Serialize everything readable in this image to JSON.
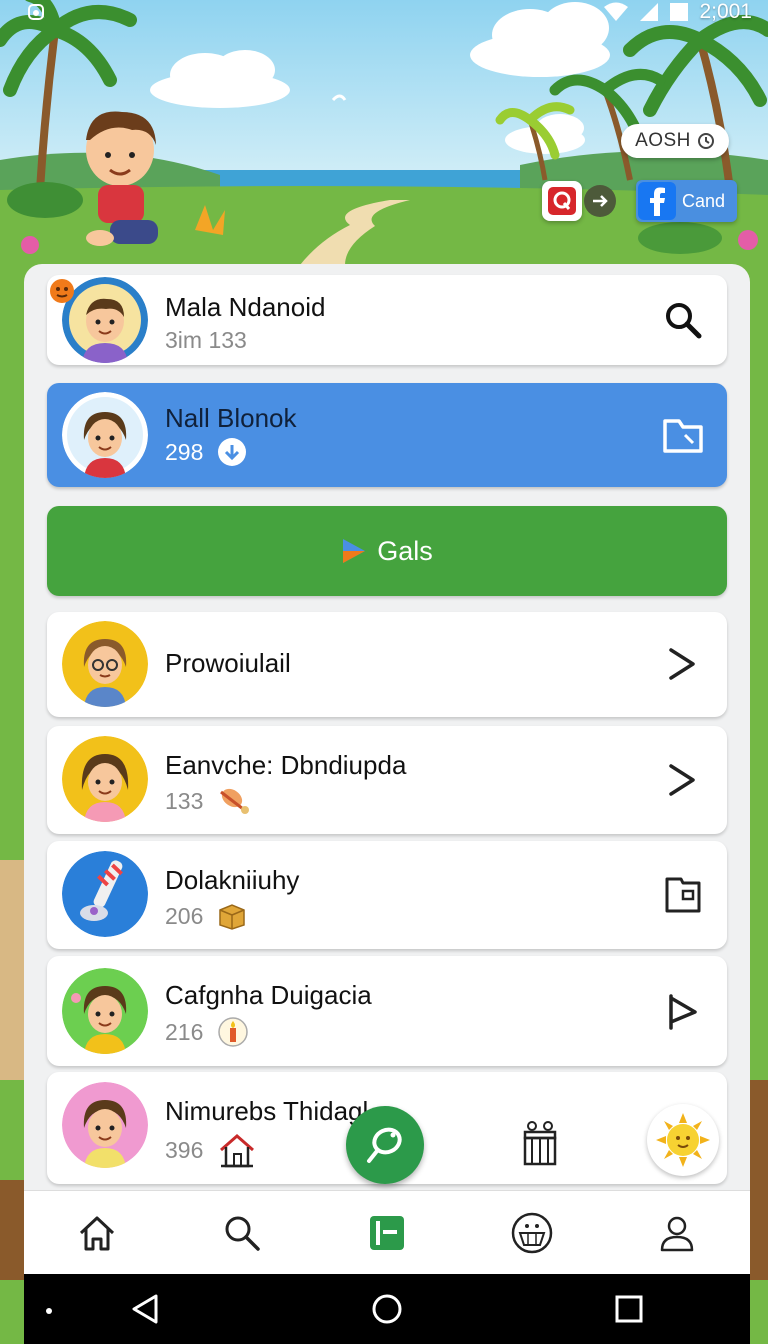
{
  "status_bar": {
    "time": "2;001"
  },
  "header": {
    "chip_label": "AOSH",
    "cand_label": "Cand"
  },
  "items": [
    {
      "title": "Mala Ndanoid",
      "sub": "3im 133"
    },
    {
      "title": "Nall Blonok",
      "sub": "298"
    },
    {
      "title": "Prowoiulail",
      "sub": ""
    },
    {
      "title": "Eanvche: Dbndiupda",
      "sub": "133"
    },
    {
      "title": "Dolakniiuhy",
      "sub": "206"
    },
    {
      "title": "Cafgnha Duigacia",
      "sub": "216"
    },
    {
      "title": "Nimurebs Thidagl",
      "sub": "396"
    }
  ],
  "primary_button": {
    "label": "Gals"
  },
  "colors": {
    "accent_blue": "#4a8fe3",
    "accent_green": "#45a33e",
    "fab_green": "#2c9a4a"
  },
  "bottom_nav": [
    "home-icon",
    "search-icon",
    "list-icon",
    "gift-icon",
    "profile-icon"
  ]
}
